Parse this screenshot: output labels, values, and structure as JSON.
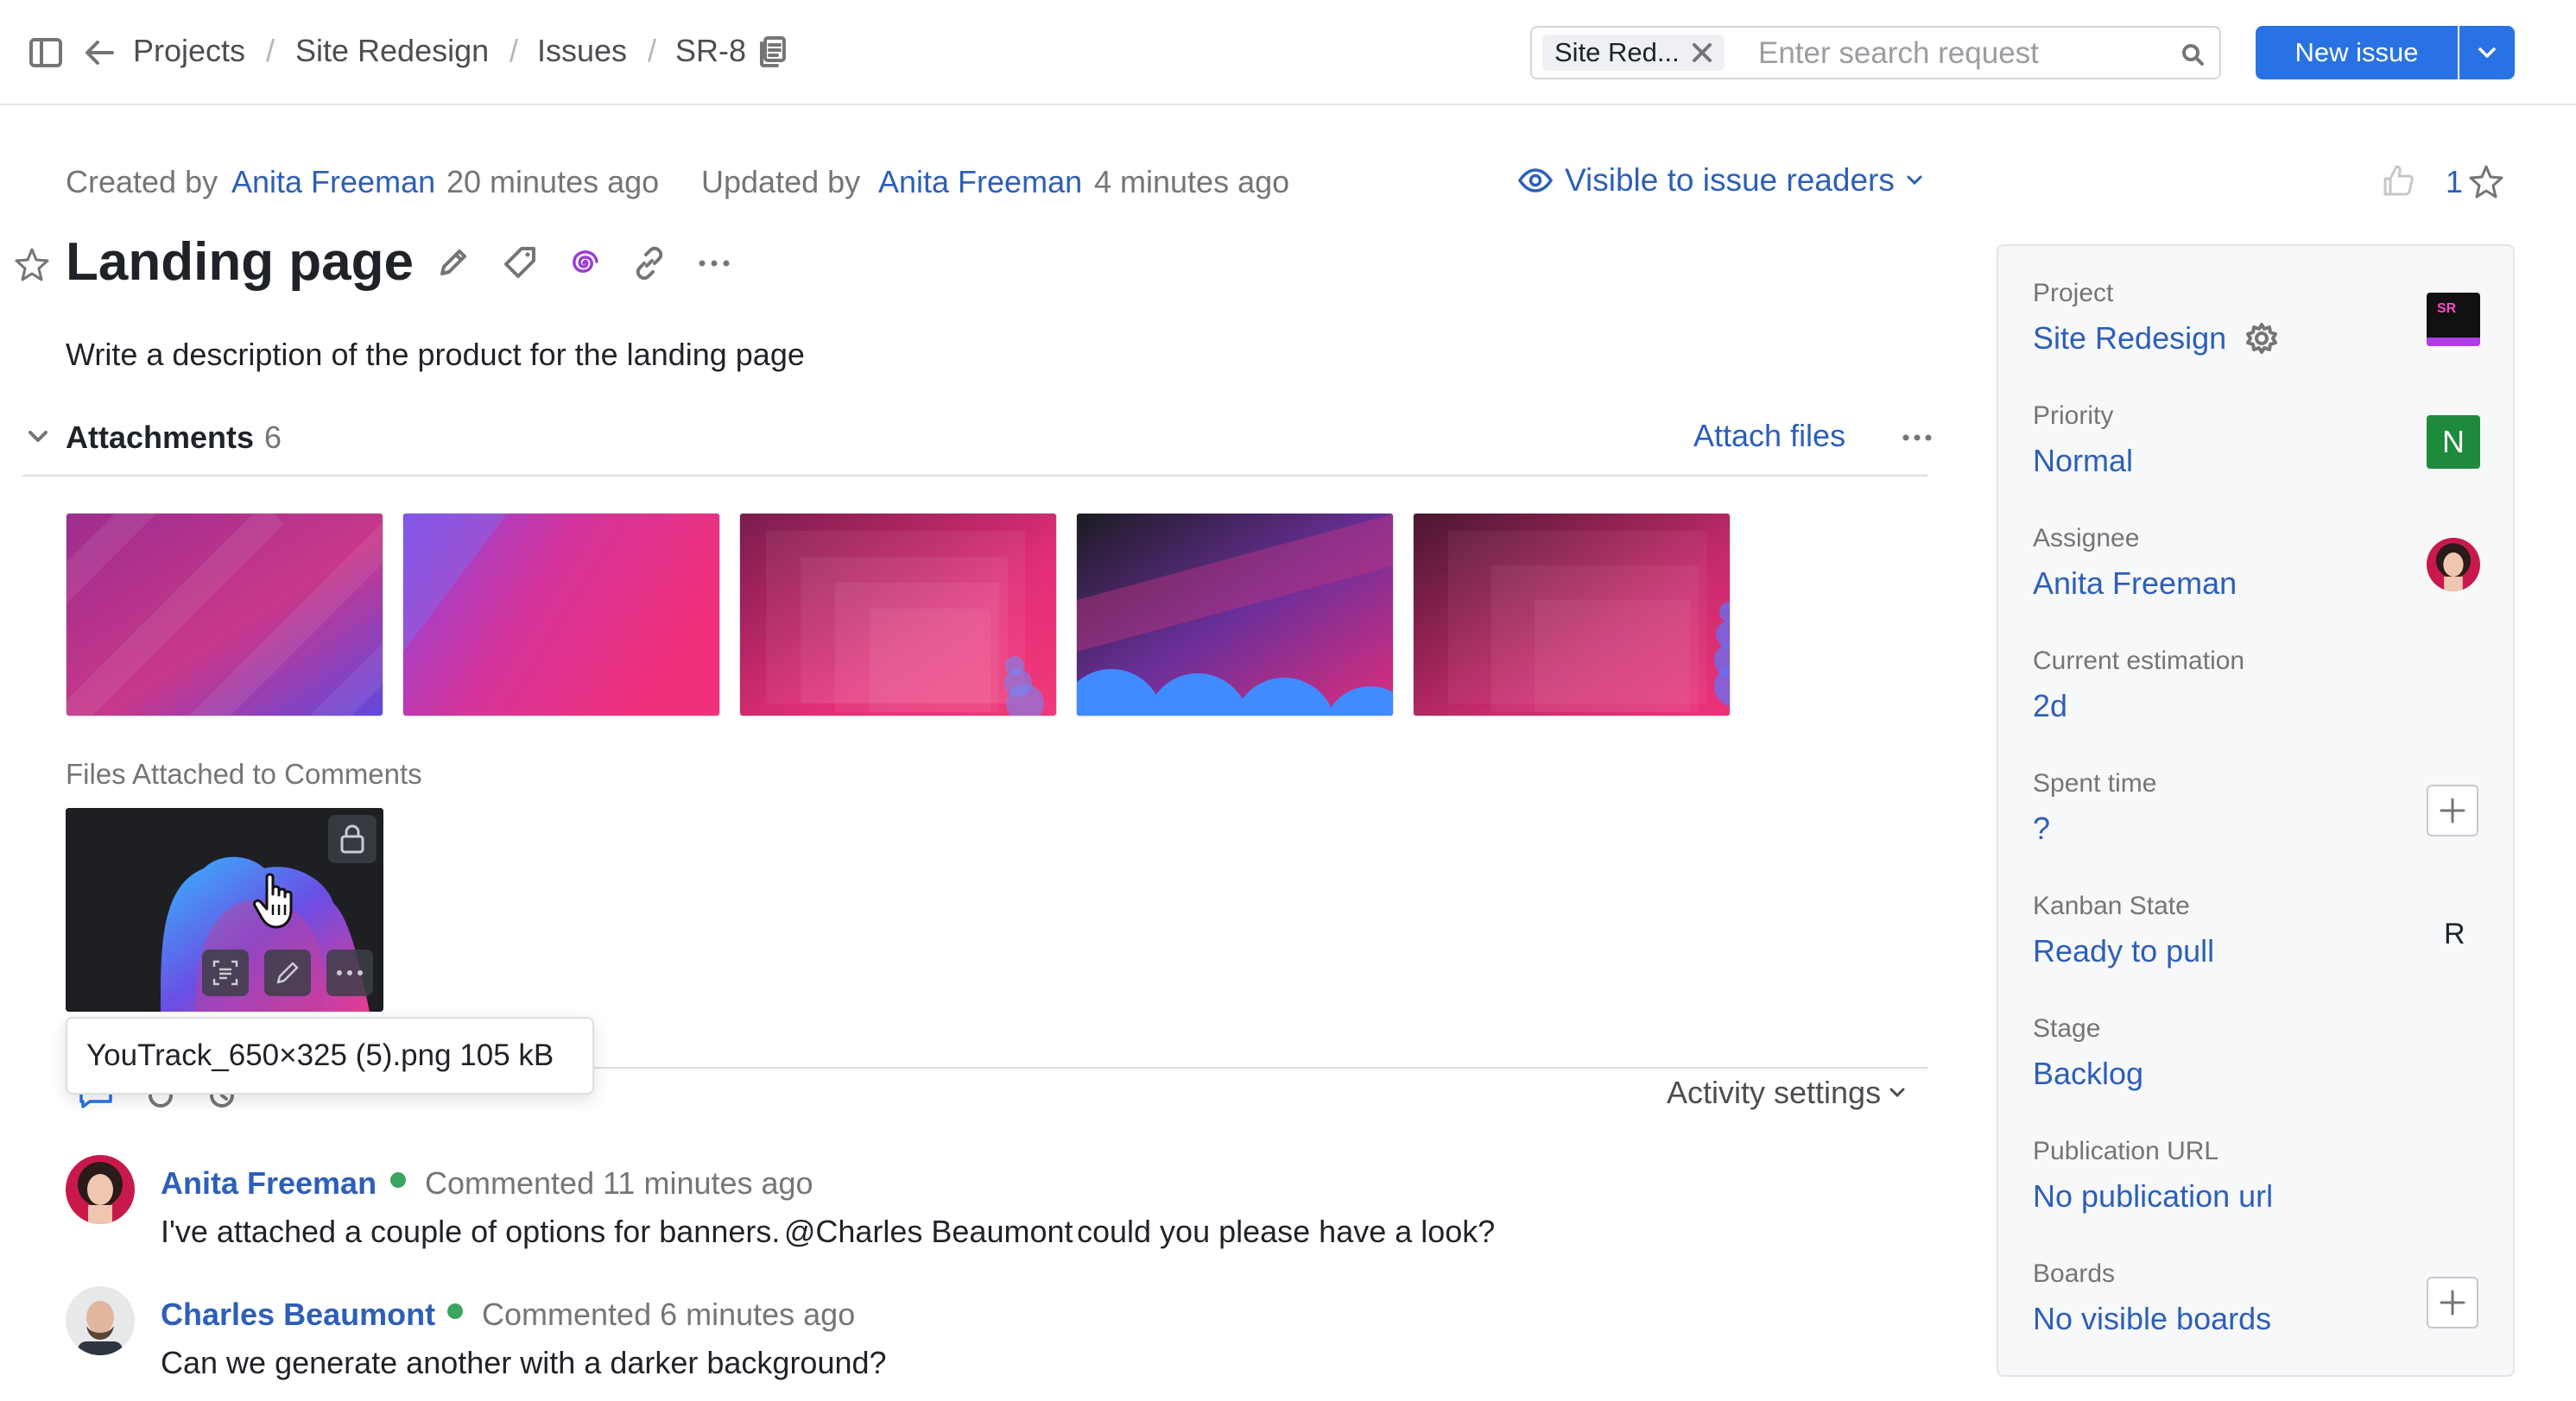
{
  "breadcrumb": {
    "items": [
      "Projects",
      "Site Redesign",
      "Issues",
      "SR-8"
    ],
    "separator": "/"
  },
  "search": {
    "chip": "Site Red...",
    "placeholder": "Enter search request"
  },
  "toolbar": {
    "new_issue_label": "New issue"
  },
  "meta": {
    "created_prefix": "Created by",
    "created_by": "Anita Freeman",
    "created_time": "20 minutes ago",
    "updated_prefix": "Updated by",
    "updated_by": "Anita Freeman",
    "updated_time": "4 minutes ago",
    "visibility": "Visible to issue readers",
    "votes": "1"
  },
  "issue": {
    "title": "Landing page",
    "description": "Write a description of the product for the landing page"
  },
  "attachments": {
    "title": "Attachments",
    "count": "6",
    "attach_label": "Attach files",
    "comments_files_label": "Files Attached to Comments",
    "tooltip": "YouTrack_650×325 (5).png 105 kB"
  },
  "activity": {
    "settings_label": "Activity settings",
    "comments": [
      {
        "author": "Anita Freeman",
        "time": "Commented 11 minutes ago",
        "text_before": "I've attached a couple of options for banners.",
        "mention": "@Charles Beaumont",
        "text_after": "could you please have a look?"
      },
      {
        "author": "Charles Beaumont",
        "time": "Commented 6 minutes ago",
        "text": "Can we generate another with a darker background?"
      }
    ]
  },
  "sidebar": {
    "project_label": "Project",
    "project_value": "Site Redesign",
    "project_badge": "SR",
    "priority_label": "Priority",
    "priority_value": "Normal",
    "priority_badge": "N",
    "assignee_label": "Assignee",
    "assignee_value": "Anita Freeman",
    "estimation_label": "Current estimation",
    "estimation_value": "2d",
    "spent_label": "Spent time",
    "spent_value": "?",
    "kanban_label": "Kanban State",
    "kanban_value": "Ready to pull",
    "kanban_badge": "R",
    "stage_label": "Stage",
    "stage_value": "Backlog",
    "url_label": "Publication URL",
    "url_value": "No publication url",
    "boards_label": "Boards",
    "boards_value": "No visible boards"
  },
  "colors": {
    "accent": "#2872e3",
    "link": "#2d5fb8",
    "priority_green": "#1e8a3c",
    "online_dot": "#3aa461"
  },
  "icons": [
    "sidebar-toggle-icon",
    "back-arrow-icon",
    "copy-icon",
    "close-icon",
    "search-icon",
    "chevron-down-icon",
    "eye-icon",
    "thumbs-up-icon",
    "star-icon",
    "pencil-icon",
    "tag-icon",
    "ai-spiral-icon",
    "link-icon",
    "more-icon",
    "gear-icon",
    "lock-icon",
    "ocr-icon",
    "plus-icon",
    "comment-icon",
    "history-icon",
    "cursor-hand-icon"
  ]
}
